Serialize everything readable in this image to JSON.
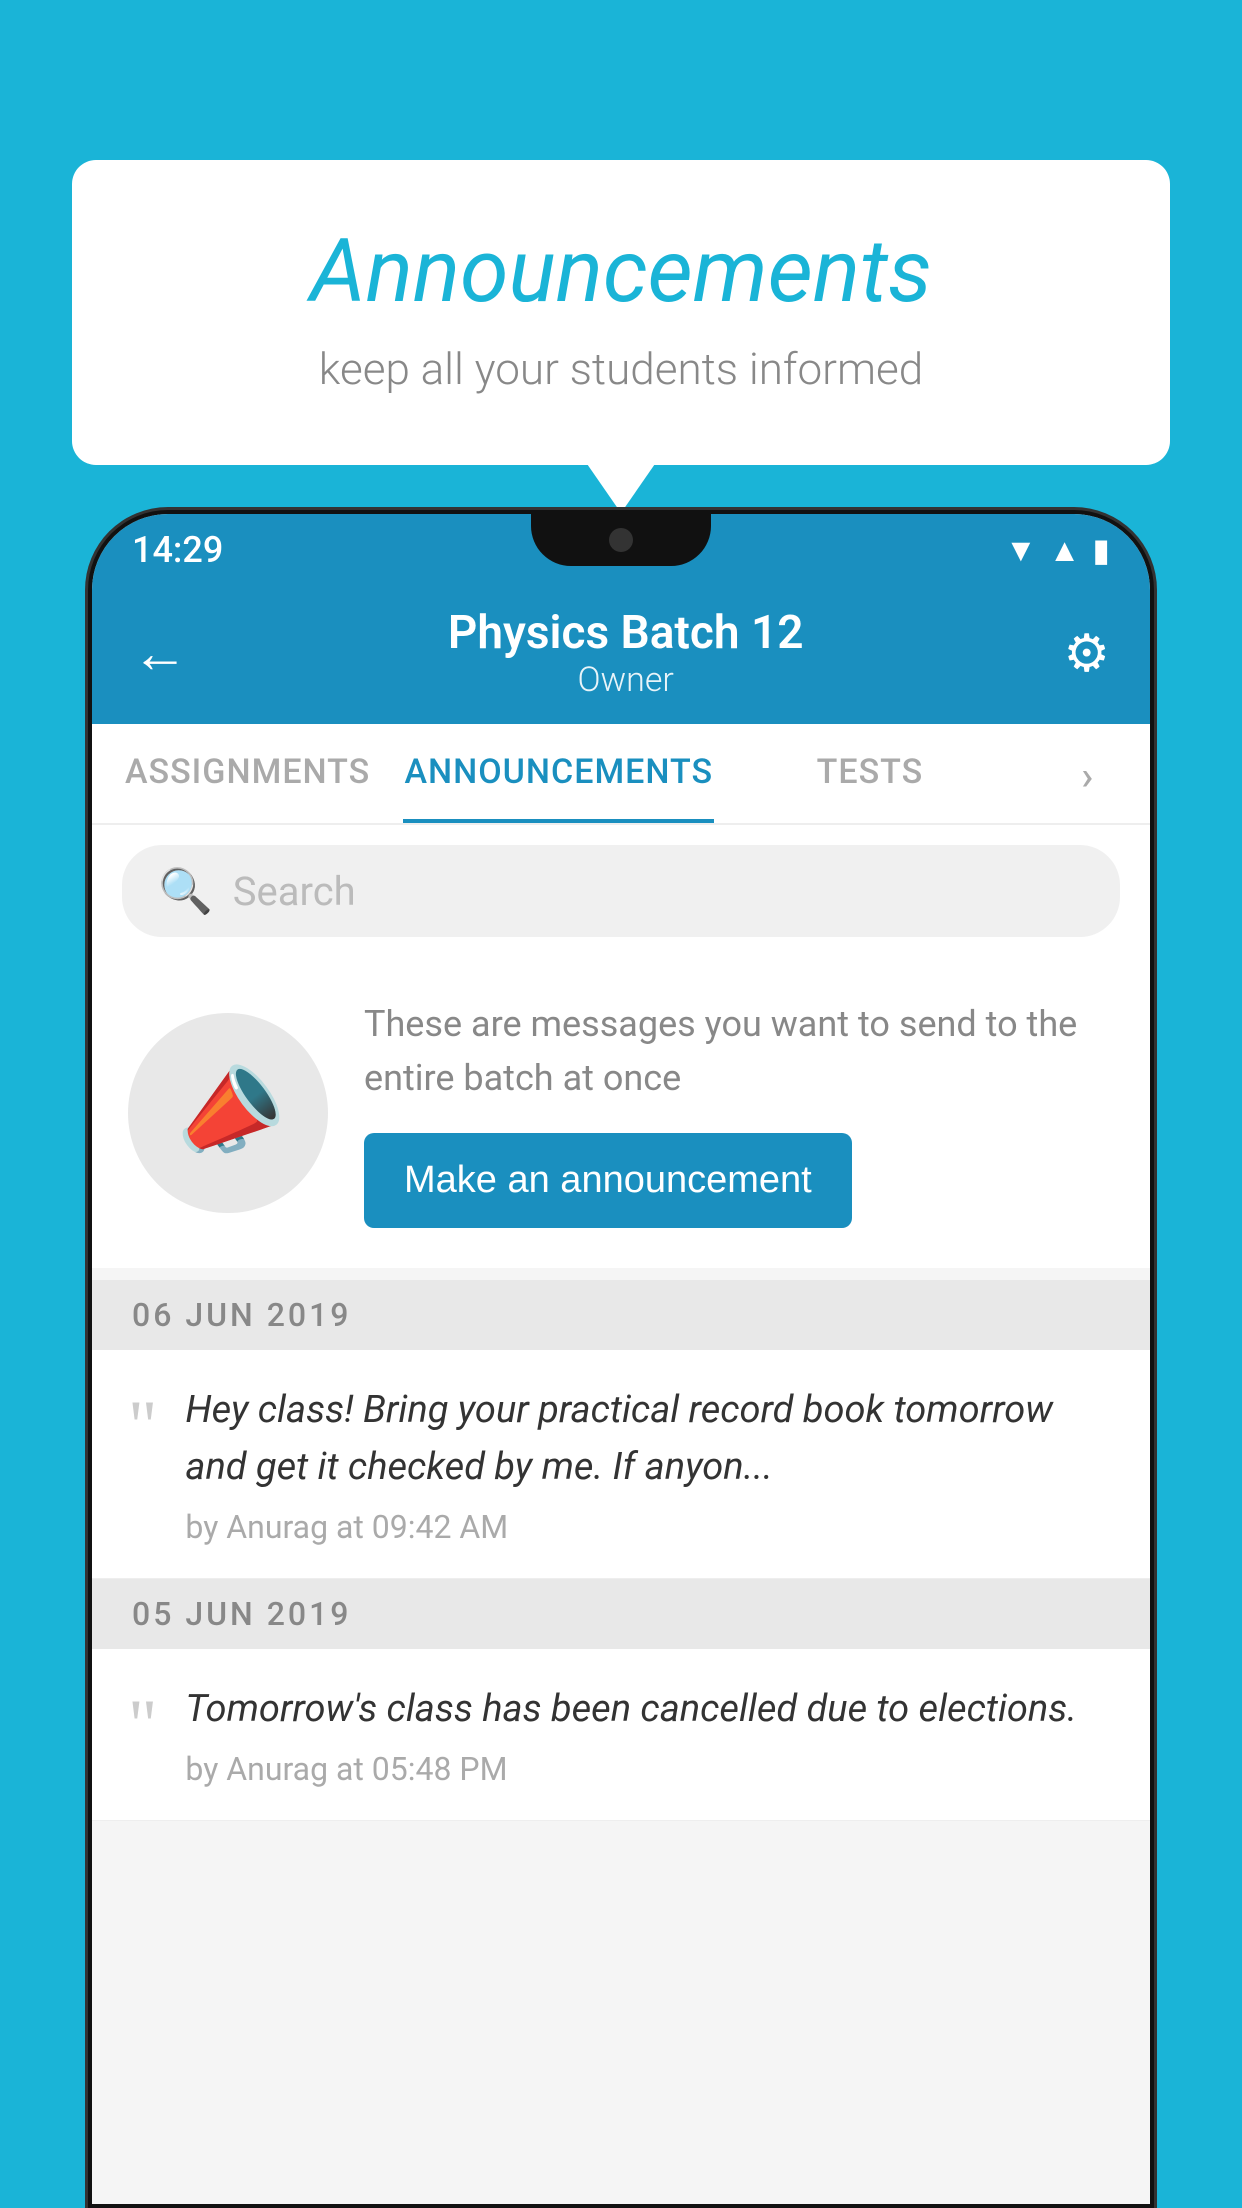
{
  "bubble": {
    "title": "Announcements",
    "subtitle": "keep all your students informed"
  },
  "phone": {
    "status": {
      "time": "14:29",
      "wifi_icon": "▲",
      "signal_icon": "▲",
      "battery_icon": "▮"
    },
    "topbar": {
      "batch_name": "Physics Batch 12",
      "owner_label": "Owner",
      "back_label": "←"
    },
    "tabs": [
      {
        "label": "ASSIGNMENTS",
        "active": false
      },
      {
        "label": "ANNOUNCEMENTS",
        "active": true
      },
      {
        "label": "TESTS",
        "active": false
      }
    ],
    "search": {
      "placeholder": "Search"
    },
    "promo": {
      "description": "These are messages you want to send to the entire batch at once",
      "button_label": "Make an announcement"
    },
    "announcements": [
      {
        "date": "06  JUN  2019",
        "text": "Hey class! Bring your practical record book tomorrow and get it checked by me. If anyon...",
        "by": "by Anurag at 09:42 AM"
      },
      {
        "date": "05  JUN  2019",
        "text": "Tomorrow's class has been cancelled due to elections.",
        "by": "by Anurag at 05:48 PM"
      }
    ]
  }
}
